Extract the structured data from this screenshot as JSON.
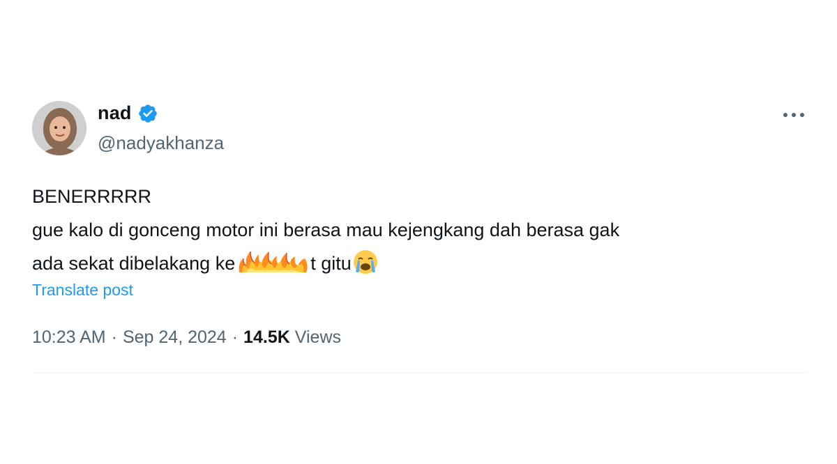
{
  "author": {
    "display_name": "nad",
    "handle": "@nadyakhanza",
    "verified": true,
    "verified_color": "#1d9bf0"
  },
  "tweet": {
    "line1": "BENERRRRR",
    "line2": "gue kalo di gonceng motor ini berasa mau kejengkang dah berasa gak",
    "line3_before": "ada sekat dibelakang ke",
    "line3_after": "t gitu",
    "censor_icon": "fire-emoji-overlay",
    "trailing_emoji": "loudly-crying-face"
  },
  "translate_label": "Translate post",
  "meta": {
    "time": "10:23 AM",
    "date": "Sep 24, 2024",
    "separator": "·",
    "views_count": "14.5K",
    "views_label": "Views"
  },
  "colors": {
    "text_primary": "#0f1419",
    "text_secondary": "#536471",
    "link": "#1d9bf0",
    "divider": "#eff3f4"
  }
}
